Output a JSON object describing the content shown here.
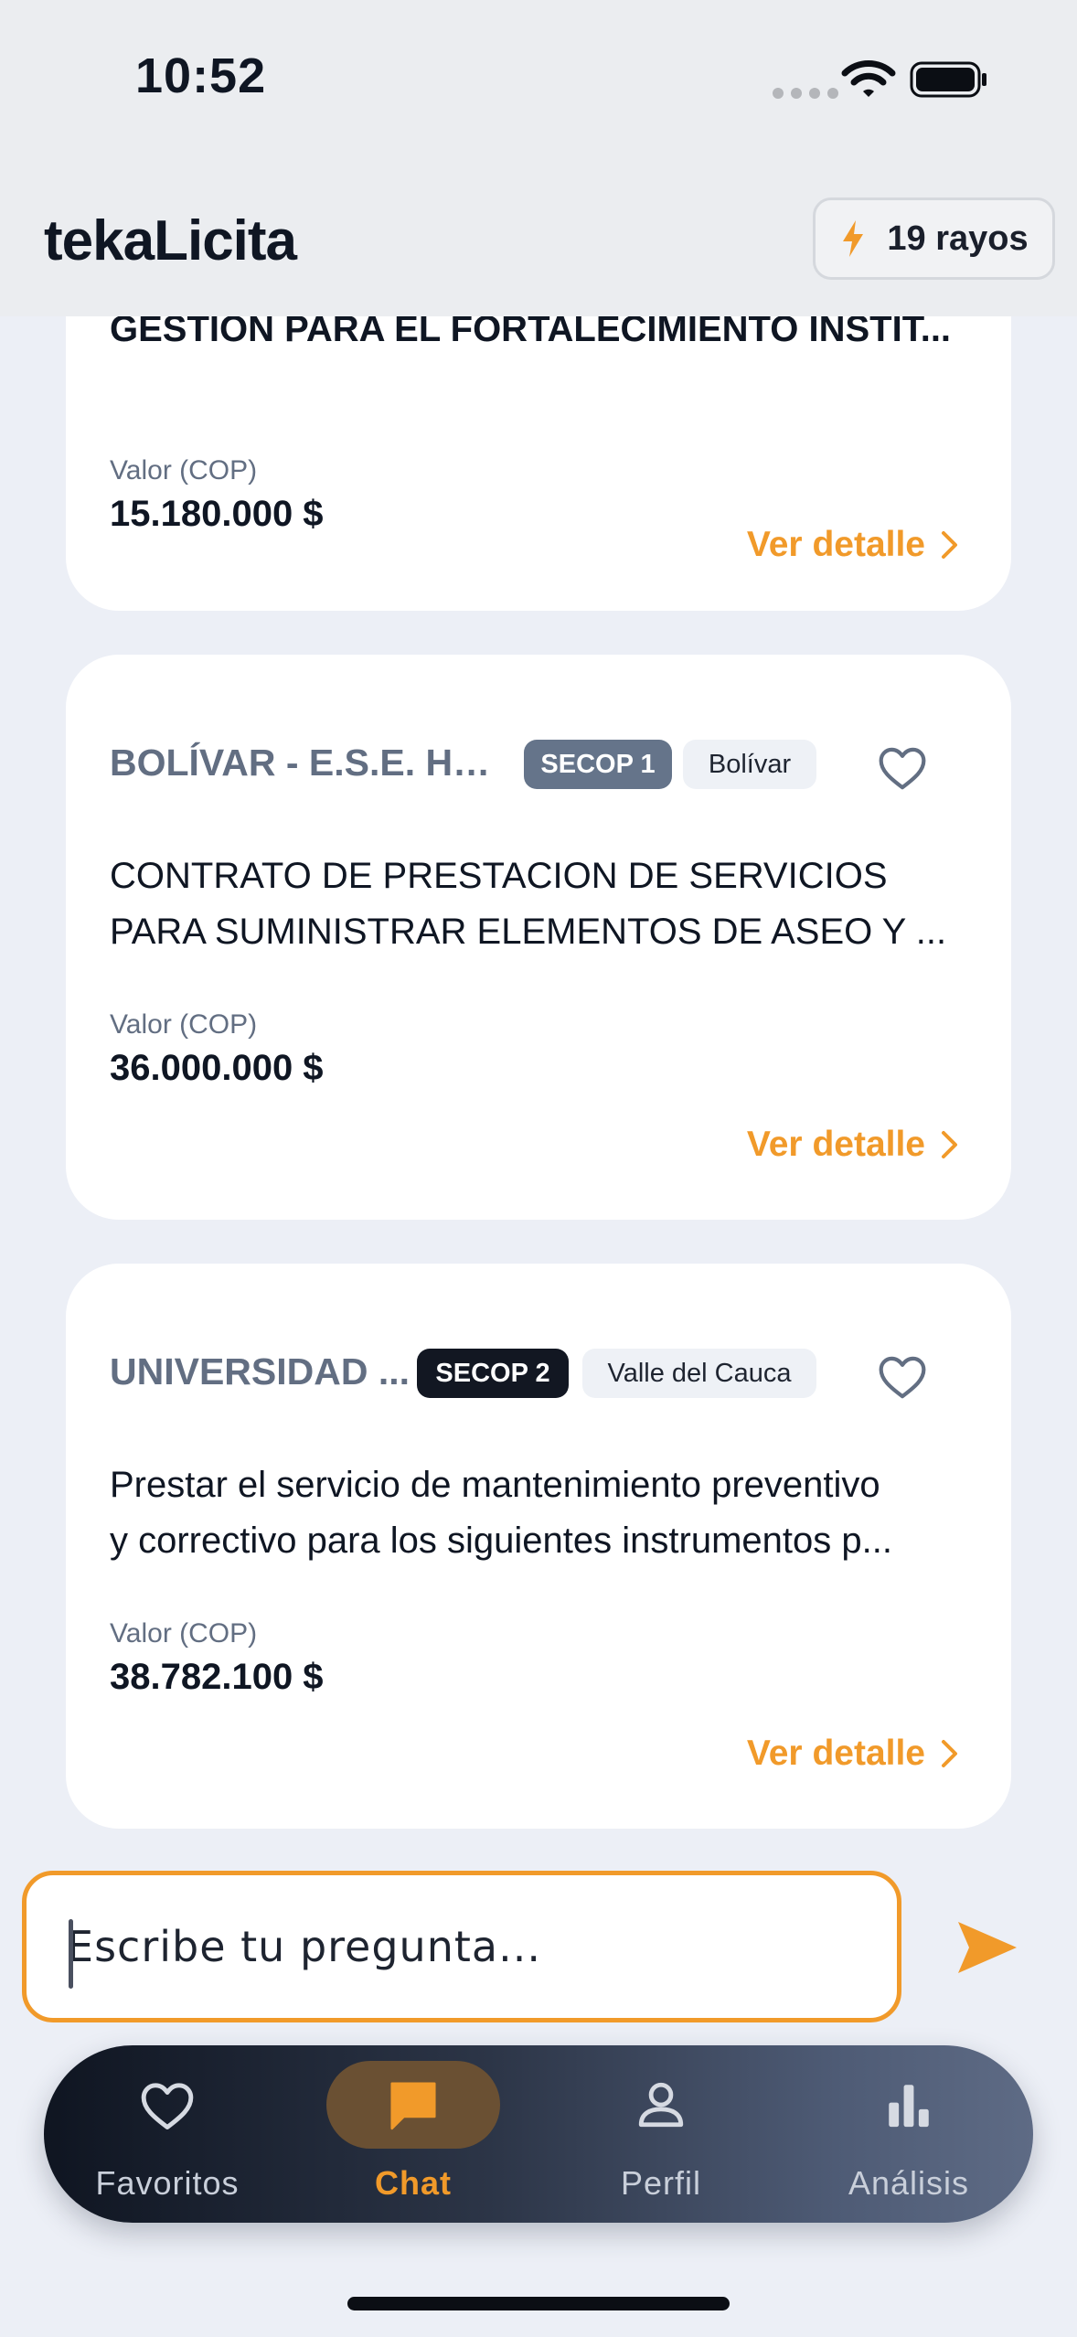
{
  "status_bar": {
    "time": "10:52"
  },
  "header": {
    "title": "tekaLicita",
    "rayos_label": "19 rayos"
  },
  "cards": [
    {
      "subject": "GESTION PARA EL FORTALECIMIENTO INSTIT...",
      "value_label": "Valor (COP)",
      "value": "15.180.000 $",
      "detail_label": "Ver detalle"
    },
    {
      "entity": "BOLÍVAR - E.S.E. HO...",
      "source_badge": "SECOP 1",
      "region": "Bolívar",
      "description_lines": [
        "CONTRATO DE PRESTACION DE SERVICIOS",
        "PARA SUMINISTRAR ELEMENTOS DE ASEO Y ..."
      ],
      "value_label": "Valor (COP)",
      "value": "36.000.000 $",
      "detail_label": "Ver detalle"
    },
    {
      "entity": "UNIVERSIDAD ...",
      "source_badge": "SECOP 2",
      "region": "Valle del Cauca",
      "description_lines": [
        "Prestar el servicio de mantenimiento preventivo",
        "y correctivo para los siguientes instrumentos p..."
      ],
      "value_label": "Valor (COP)",
      "value": "38.782.100 $",
      "detail_label": "Ver detalle"
    }
  ],
  "chat": {
    "placeholder": "Escribe tu pregunta..."
  },
  "tabs": [
    {
      "label": "Favoritos",
      "icon": "heart-icon"
    },
    {
      "label": "Chat",
      "icon": "chat-bubble-icon",
      "active": true
    },
    {
      "label": "Perfil",
      "icon": "person-icon"
    },
    {
      "label": "Análisis",
      "icon": "bar-chart-icon"
    }
  ],
  "colors": {
    "accent": "#F19A2A",
    "background": "#ECEFF6",
    "card": "#FFFFFF",
    "muted_text": "#626E82"
  }
}
